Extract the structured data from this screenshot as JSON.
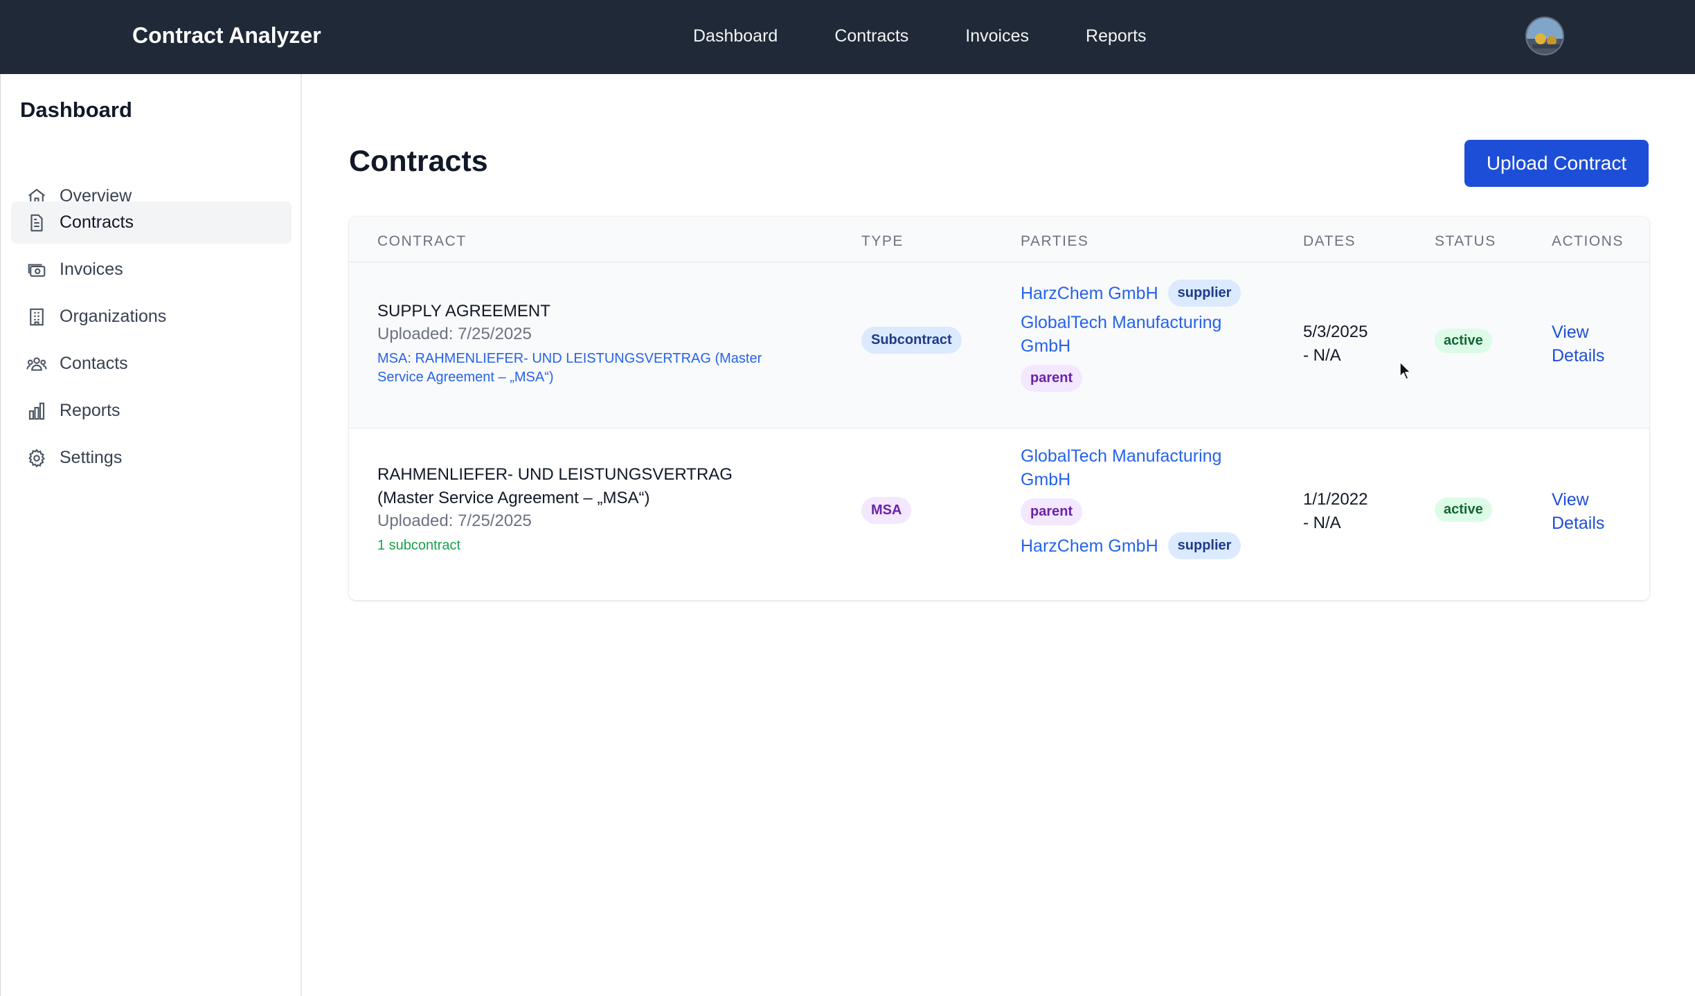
{
  "app": {
    "title": "Contract Analyzer"
  },
  "topnav": {
    "links": [
      "Dashboard",
      "Contracts",
      "Invoices",
      "Reports"
    ]
  },
  "sidebar": {
    "title": "Dashboard",
    "items": [
      {
        "label": "Overview",
        "icon": "home-icon"
      },
      {
        "label": "Contracts",
        "icon": "document-icon",
        "active": true
      },
      {
        "label": "Invoices",
        "icon": "cash-icon"
      },
      {
        "label": "Organizations",
        "icon": "building-icon"
      },
      {
        "label": "Contacts",
        "icon": "users-icon"
      },
      {
        "label": "Reports",
        "icon": "chart-bar-icon"
      },
      {
        "label": "Settings",
        "icon": "gear-icon"
      }
    ]
  },
  "main": {
    "title": "Contracts",
    "upload_label": "Upload Contract",
    "table": {
      "columns": [
        "CONTRACT",
        "TYPE",
        "PARTIES",
        "DATES",
        "STATUS",
        "ACTIONS"
      ],
      "rows": [
        {
          "title_line1": "SUPPLY AGREEMENT",
          "uploaded": "Uploaded: 7/25/2025",
          "link_line1": "MSA: RAHMENLIEFER- UND LEISTUNGSVERTRAG (Master",
          "link_line2": "Service Agreement – „MSA“)",
          "type": "Subcontract",
          "party1": "HarzChem GmbH",
          "party1_role": "supplier",
          "party2_line1": "GlobalTech Manufacturing",
          "party2_line2": "GmbH",
          "party2_role": "parent",
          "date_line1": "5/3/2025",
          "date_line2": "- N/A",
          "status": "active",
          "action_line1": "View",
          "action_line2": "Details"
        },
        {
          "title_line1": "RAHMENLIEFER- UND LEISTUNGSVERTRAG",
          "title_line2": "(Master Service Agreement – „MSA“)",
          "uploaded": "Uploaded: 7/25/2025",
          "subcontracts": "1 subcontract",
          "type": "MSA",
          "party1_line1": "GlobalTech Manufacturing",
          "party1_line2": "GmbH",
          "party1_role": "parent",
          "party2": "HarzChem GmbH",
          "party2_role": "supplier",
          "date_line1": "1/1/2022",
          "date_line2": "- N/A",
          "status": "active",
          "action_line1": "View",
          "action_line2": "Details"
        }
      ]
    }
  },
  "colors": {
    "nav_bg": "#1f2937",
    "accent": "#1d4ed8",
    "link": "#2563eb",
    "status_active": "#166534"
  }
}
